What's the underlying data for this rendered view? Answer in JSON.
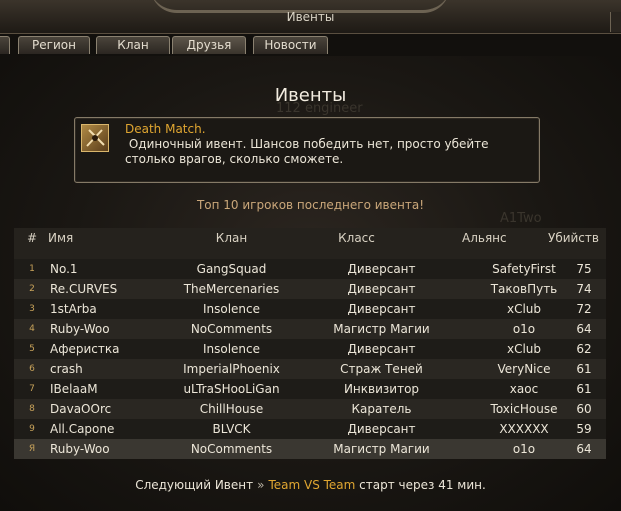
{
  "window": {
    "title": "Ивенты"
  },
  "tabs": [
    {
      "label": "Регион"
    },
    {
      "label": "Клан"
    },
    {
      "label": "Друзья"
    },
    {
      "label": "Новости"
    }
  ],
  "page": {
    "heading": "Ивенты"
  },
  "background_names": [
    "112 engineer",
    "A1Two"
  ],
  "event": {
    "title": "Death Match.",
    "description": " Одиночный ивент. Шансов победить нет, просто убейте\nстолько врагов, сколько сможете.",
    "icon": "crossed-swords-icon"
  },
  "top10_label": "Топ 10 игроков последнего ивента!",
  "table": {
    "headers": {
      "num": "#",
      "name": "Имя",
      "clan": "Клан",
      "class": "Класс",
      "alliance": "Альянс",
      "kills": "Убийств"
    },
    "rows": [
      {
        "num": "1",
        "name": "No.1",
        "clan": "GangSquad",
        "class": "Диверсант",
        "alliance": "SafetyFirst",
        "kills": "75"
      },
      {
        "num": "2",
        "name": "Re.CURVES",
        "clan": "TheMercenaries",
        "class": "Диверсант",
        "alliance": "ТаковПуть",
        "kills": "74"
      },
      {
        "num": "3",
        "name": "1stArba",
        "clan": "Insolence",
        "class": "Диверсант",
        "alliance": "xClub",
        "kills": "72"
      },
      {
        "num": "4",
        "name": "Ruby-Woo",
        "clan": "NoComments",
        "class": "Магистр Магии",
        "alliance": "o1o",
        "kills": "64"
      },
      {
        "num": "5",
        "name": "Аферистка",
        "clan": "Insolence",
        "class": "Диверсант",
        "alliance": "xClub",
        "kills": "62"
      },
      {
        "num": "6",
        "name": "crash",
        "clan": "ImperialPhoenix",
        "class": "Страж Теней",
        "alliance": "VeryNice",
        "kills": "61"
      },
      {
        "num": "7",
        "name": "IBelaaM",
        "clan": "uLTraSHooLiGan",
        "class": "Инквизитор",
        "alliance": "xaoc",
        "kills": "61"
      },
      {
        "num": "8",
        "name": "DavaOOrc",
        "clan": "ChillHouse",
        "class": "Каратель",
        "alliance": "ToxicHouse",
        "kills": "60"
      },
      {
        "num": "9",
        "name": "All.Capone",
        "clan": "BLVCK",
        "class": "Диверсант",
        "alliance": "XXXXXX",
        "kills": "59"
      }
    ],
    "me": {
      "num": "Я",
      "name": "Ruby-Woo",
      "clan": "NoComments",
      "class": "Магистр Магии",
      "alliance": "o1o",
      "kills": "64"
    }
  },
  "footer": {
    "prefix": "Следующий Ивент",
    "arrows": "»",
    "team": "Team VS Team",
    "suffix": "старт через 41 мин."
  }
}
